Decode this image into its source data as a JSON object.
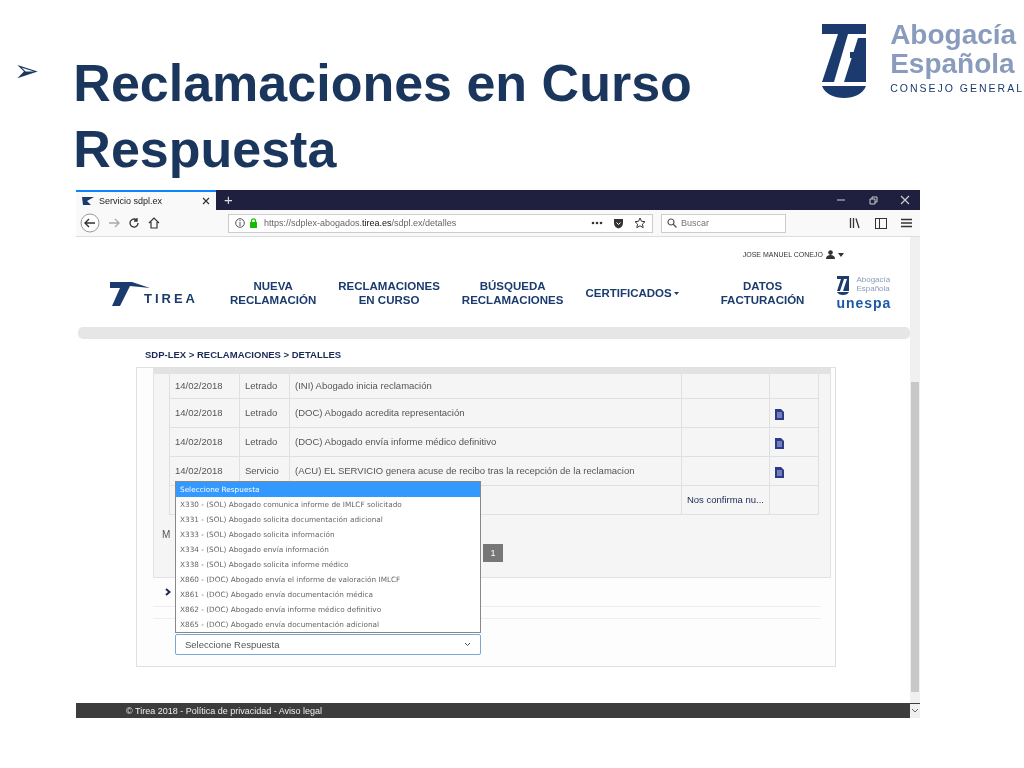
{
  "slide": {
    "bullet": "➢",
    "title_lines": [
      "Reclamaciones en Curso",
      "Respuesta"
    ],
    "logo": {
      "line_1": "Abogacía",
      "line_2": "Española",
      "line_3": "CONSEJO GENERAL"
    }
  },
  "browser": {
    "tab": {
      "title": "Servicio sdpl.ex",
      "selected": true
    },
    "new_tab": "+",
    "url": {
      "prefix": "https://sdplex-abogados.",
      "domain": "tirea.es",
      "suffix": "/sdpl.ex/detalles"
    },
    "search": {
      "placeholder": "Buscar"
    }
  },
  "site": {
    "user": "JOSE MANUEL CONEJO",
    "brand": "TIREA",
    "nav": [
      {
        "kind": "link",
        "lines": [
          "NUEVA",
          "RECLAMACIÓN"
        ]
      },
      {
        "kind": "link",
        "lines": [
          "RECLAMACIONES",
          "EN CURSO"
        ]
      },
      {
        "kind": "link",
        "lines": [
          "BÚSQUEDA",
          "RECLAMACIONES"
        ]
      },
      {
        "kind": "dropdown",
        "lines": [
          "CERTIFICADOS"
        ]
      },
      {
        "kind": "link",
        "lines": [
          "DATOS",
          "FACTURACIÓN"
        ]
      }
    ],
    "partner_logo": {
      "line_1": "Abogacía",
      "line_2": "Española",
      "line_3": "unespa"
    },
    "breadcrumb": "SDP-LEX > RECLAMACIONES > DETALLES",
    "table": {
      "rows": [
        {
          "date": "14/02/2018",
          "actor": "Letrado",
          "description": "(INI) Abogado inicia reclamación",
          "document": false
        },
        {
          "date": "14/02/2018",
          "actor": "Letrado",
          "description": "(DOC) Abogado acredita representación",
          "document": true
        },
        {
          "date": "14/02/2018",
          "actor": "Letrado",
          "description": "(DOC) Abogado envía informe médico definitivo",
          "document": true
        },
        {
          "date": "14/02/2018",
          "actor": "Servicio",
          "description": "(ACU) EL SERVICIO genera acuse de recibo tras la recepción de la reclamacion",
          "document": true
        },
        {
          "column_4": "Nos confirma nu...",
          "document": false
        }
      ]
    },
    "label_partial": "M",
    "pagination": [
      {
        "label": "1",
        "selected": true
      }
    ],
    "response_select": {
      "value": "Seleccione Respuesta",
      "expanded": true,
      "options": [
        {
          "label": "Seleccione Respuesta",
          "selected": true
        },
        {
          "label": "X330 - (SOL) Abogado comunica informe de IMLCF solicitado",
          "selected": false
        },
        {
          "label": "X331 - (SOL) Abogado solicita documentación adicional",
          "selected": false
        },
        {
          "label": "X333 - (SOL) Abogado solicita información",
          "selected": false
        },
        {
          "label": "X334 - (SOL) Abogado envía información",
          "selected": false
        },
        {
          "label": "X338 - (SOL) Abogado solicita informe médico",
          "selected": false
        },
        {
          "label": "X860 - (DOC) Abogado envía el informe de valoración IMLCF",
          "selected": false
        },
        {
          "label": "X861 - (DOC) Abogado envía documentación médica",
          "selected": false
        },
        {
          "label": "X862 - (DOC) Abogado envía informe médico definitivo",
          "selected": false
        },
        {
          "label": "X865 - (DOC) Abogado envía documentación adicional",
          "selected": false
        }
      ]
    },
    "footer": "© Tirea 2018 - Política de privacidad - Aviso legal"
  }
}
